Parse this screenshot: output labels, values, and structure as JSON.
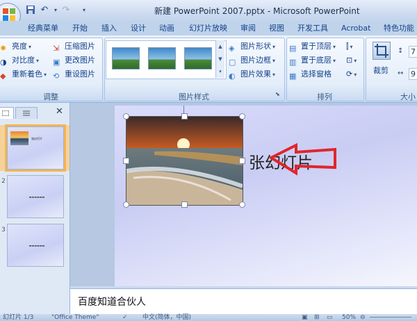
{
  "window": {
    "title": "新建 PowerPoint 2007.pptx - Microsoft PowerPoint"
  },
  "tabs": [
    "经典菜单",
    "开始",
    "插入",
    "设计",
    "动画",
    "幻灯片放映",
    "审阅",
    "视图",
    "开发工具",
    "Acrobat",
    "特色功能"
  ],
  "ribbon": {
    "adjust": {
      "label": "调整",
      "items": [
        "亮度",
        "对比度",
        "重新着色",
        "压缩图片",
        "更改图片",
        "重设图片"
      ]
    },
    "picture_styles": {
      "label": "图片样式",
      "items": [
        "图片形状",
        "图片边框",
        "图片效果"
      ]
    },
    "arrange": {
      "label": "排列",
      "items": [
        "置于顶层",
        "置于底层",
        "选择窗格"
      ]
    },
    "size": {
      "label": "大小",
      "crop": "裁剪",
      "height": "7",
      "width": "9"
    }
  },
  "slide": {
    "title": "张幻灯片"
  },
  "notes": {
    "text": "百度知道合伙人"
  },
  "status": {
    "slide_info": "幻灯片 1/3",
    "theme": "\"Office Theme\"",
    "language": "中文(简体，中国)",
    "zoom": "50%"
  },
  "colors": {
    "arrow": "#e0262b",
    "selection": "#f4b455",
    "ribbon_text": "#15428b"
  }
}
